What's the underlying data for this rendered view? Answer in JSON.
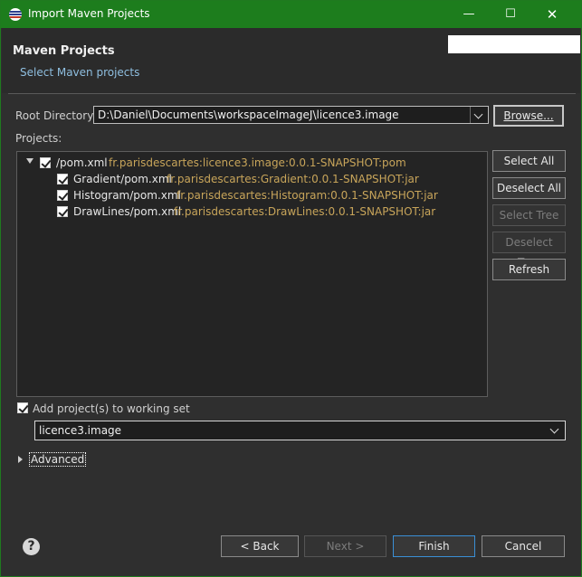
{
  "window": {
    "title": "Import Maven Projects",
    "controls": {
      "minimize": "—",
      "maximize": "☐",
      "close": "✕"
    }
  },
  "header": {
    "title": "Maven Projects",
    "subtitle": "Select Maven projects"
  },
  "root_directory": {
    "label": "Root Directory:",
    "value": "D:\\Daniel\\Documents\\workspaceImageJ\\licence3.image",
    "browse_label": "Browse..."
  },
  "projects": {
    "label": "Projects:",
    "items": [
      {
        "name": "/pom.xml",
        "gav": "fr.parisdescartes:licence3.image:0.0.1-SNAPSHOT:pom",
        "checked": true
      },
      {
        "name": "Gradient/pom.xml",
        "gav": "fr.parisdescartes:Gradient:0.0.1-SNAPSHOT:jar",
        "checked": true
      },
      {
        "name": "Histogram/pom.xml",
        "gav": "fr.parisdescartes:Histogram:0.0.1-SNAPSHOT:jar",
        "checked": true
      },
      {
        "name": "DrawLines/pom.xml",
        "gav": "fr.parisdescartes:DrawLines:0.0.1-SNAPSHOT:jar",
        "checked": true
      }
    ],
    "buttons": {
      "select_all": "Select All",
      "deselect_all": "Deselect All",
      "select_tree": "Select Tree",
      "deselect_tree": "Deselect Tree",
      "refresh": "Refresh"
    }
  },
  "working_set": {
    "label": "Add project(s) to working set",
    "checked": true,
    "value": "licence3.image"
  },
  "advanced": {
    "label": "Advanced"
  },
  "footer": {
    "help_icon": "?",
    "back": "< Back",
    "next": "Next >",
    "finish": "Finish",
    "cancel": "Cancel"
  }
}
